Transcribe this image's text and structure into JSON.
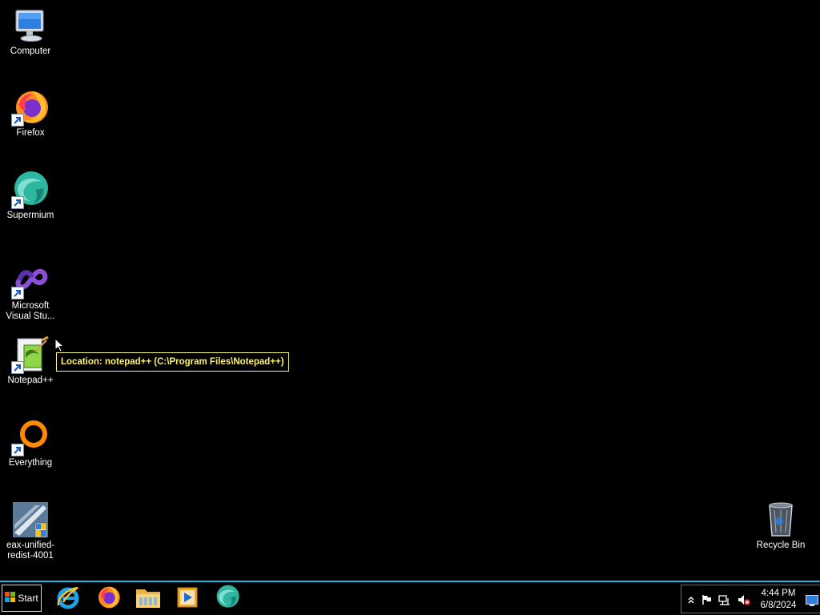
{
  "desktop": {
    "icons": [
      {
        "label": "Computer",
        "icon": "computer-icon",
        "shortcut": false
      },
      {
        "label": "Firefox",
        "icon": "firefox-icon",
        "shortcut": true
      },
      {
        "label": "Supermium",
        "icon": "supermium-icon",
        "shortcut": true
      },
      {
        "label": "Microsoft Visual Stu...",
        "icon": "visual-studio-icon",
        "shortcut": true
      },
      {
        "label": "Notepad++",
        "icon": "notepadpp-icon",
        "shortcut": true
      },
      {
        "label": "Everything",
        "icon": "everything-icon",
        "shortcut": true
      },
      {
        "label": "eax-unified-redist-4001",
        "icon": "installer-icon",
        "shortcut": false
      },
      {
        "label": "Recycle Bin",
        "icon": "recycle-bin-icon",
        "shortcut": false
      }
    ],
    "tooltip": "Location: notepad++ (C:\\Program Files\\Notepad++)"
  },
  "taskbar": {
    "start_label": "Start",
    "pinned": [
      {
        "name": "Internet Explorer",
        "icon": "internet-explorer-icon"
      },
      {
        "name": "Firefox",
        "icon": "firefox-icon"
      },
      {
        "name": "File Explorer",
        "icon": "folder-icon"
      },
      {
        "name": "Media Player",
        "icon": "media-player-icon"
      },
      {
        "name": "Supermium",
        "icon": "supermium-icon"
      }
    ],
    "tray": {
      "time": "4:44 PM",
      "date": "6/8/2024"
    }
  },
  "colors": {
    "desktop_bg": "#000000",
    "taskbar_border": "#19b6e6",
    "tooltip_text": "#fff36a",
    "tooltip_border": "#fffb80"
  }
}
